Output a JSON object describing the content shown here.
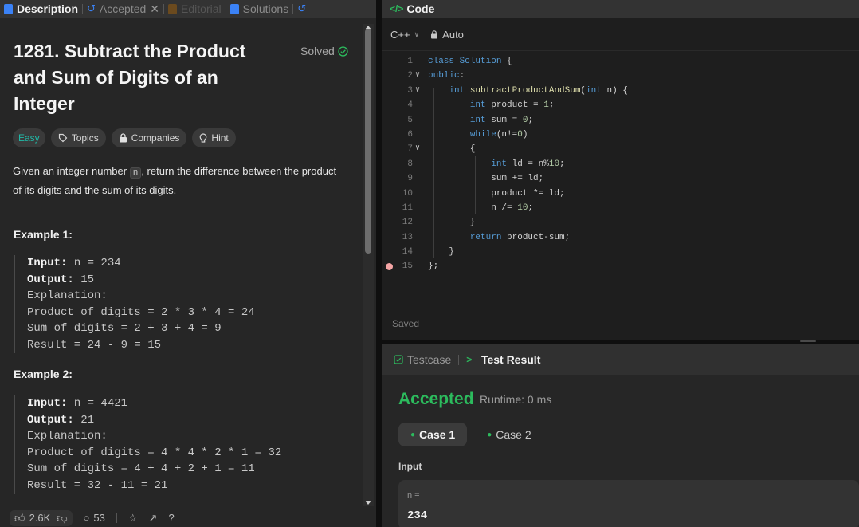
{
  "tabs": [
    {
      "label": "Description"
    },
    {
      "label": "Accepted"
    },
    {
      "label": "Editorial"
    },
    {
      "label": "Solutions"
    }
  ],
  "problem": {
    "title": "1281. Subtract the Product and Sum of Digits of an Integer",
    "status": "Solved",
    "tags": [
      "Easy",
      "Topics",
      "Companies",
      "Hint"
    ],
    "desc_pre": "Given an integer number ",
    "desc_code": "n",
    "desc_post": ", return the difference between the product of its digits and the sum of its digits.",
    "examples": [
      {
        "heading": "Example 1:",
        "input_label": "Input:",
        "input_value": " n = 234",
        "output_label": "Output:",
        "output_value": " 15",
        "explanation_label": "Explanation:",
        "lines": [
          "Product of digits = 2 * 3 * 4 = 24",
          "Sum of digits = 2 + 3 + 4 = 9",
          "Result = 24 - 9 = 15"
        ]
      },
      {
        "heading": "Example 2:",
        "input_label": "Input:",
        "input_value": " n = 4421",
        "output_label": "Output:",
        "output_value": " 21",
        "explanation_label": "Explanation:",
        "lines": [
          "Product of digits = 4 * 4 * 2 * 1 = 32",
          "Sum of digits = 4 + 4 + 2 + 1 = 11",
          "Result = 32 - 11 = 21"
        ]
      }
    ]
  },
  "footer": {
    "likes": "2.6K",
    "comments": "53"
  },
  "code": {
    "header": "Code",
    "language": "C++",
    "mode": "Auto",
    "status": "Saved",
    "lines": [
      {
        "n": "1",
        "text": "class Solution {"
      },
      {
        "n": "2",
        "text": "public:"
      },
      {
        "n": "3",
        "text": "    int subtractProductAndSum(int n) {"
      },
      {
        "n": "4",
        "text": "        int product = 1;"
      },
      {
        "n": "5",
        "text": "        int sum = 0;"
      },
      {
        "n": "6",
        "text": "        while(n!=0)"
      },
      {
        "n": "7",
        "text": "        {"
      },
      {
        "n": "8",
        "text": "            int ld = n%10;"
      },
      {
        "n": "9",
        "text": "            sum += ld;"
      },
      {
        "n": "10",
        "text": "            product *= ld;"
      },
      {
        "n": "11",
        "text": "            n /= 10;"
      },
      {
        "n": "12",
        "text": "        }"
      },
      {
        "n": "13",
        "text": "        return product-sum;"
      },
      {
        "n": "14",
        "text": "    }"
      },
      {
        "n": "15",
        "text": "};"
      }
    ]
  },
  "result": {
    "tabs": [
      "Testcase",
      "Test Result"
    ],
    "status": "Accepted",
    "runtime": "Runtime: 0 ms",
    "cases": [
      "Case 1",
      "Case 2"
    ],
    "input_label": "Input",
    "var_label": "n =",
    "var_value": "234"
  },
  "colors": {
    "accepted": "#2cbb5d",
    "easy": "#21b8a6",
    "keyword": "#569cd6"
  }
}
